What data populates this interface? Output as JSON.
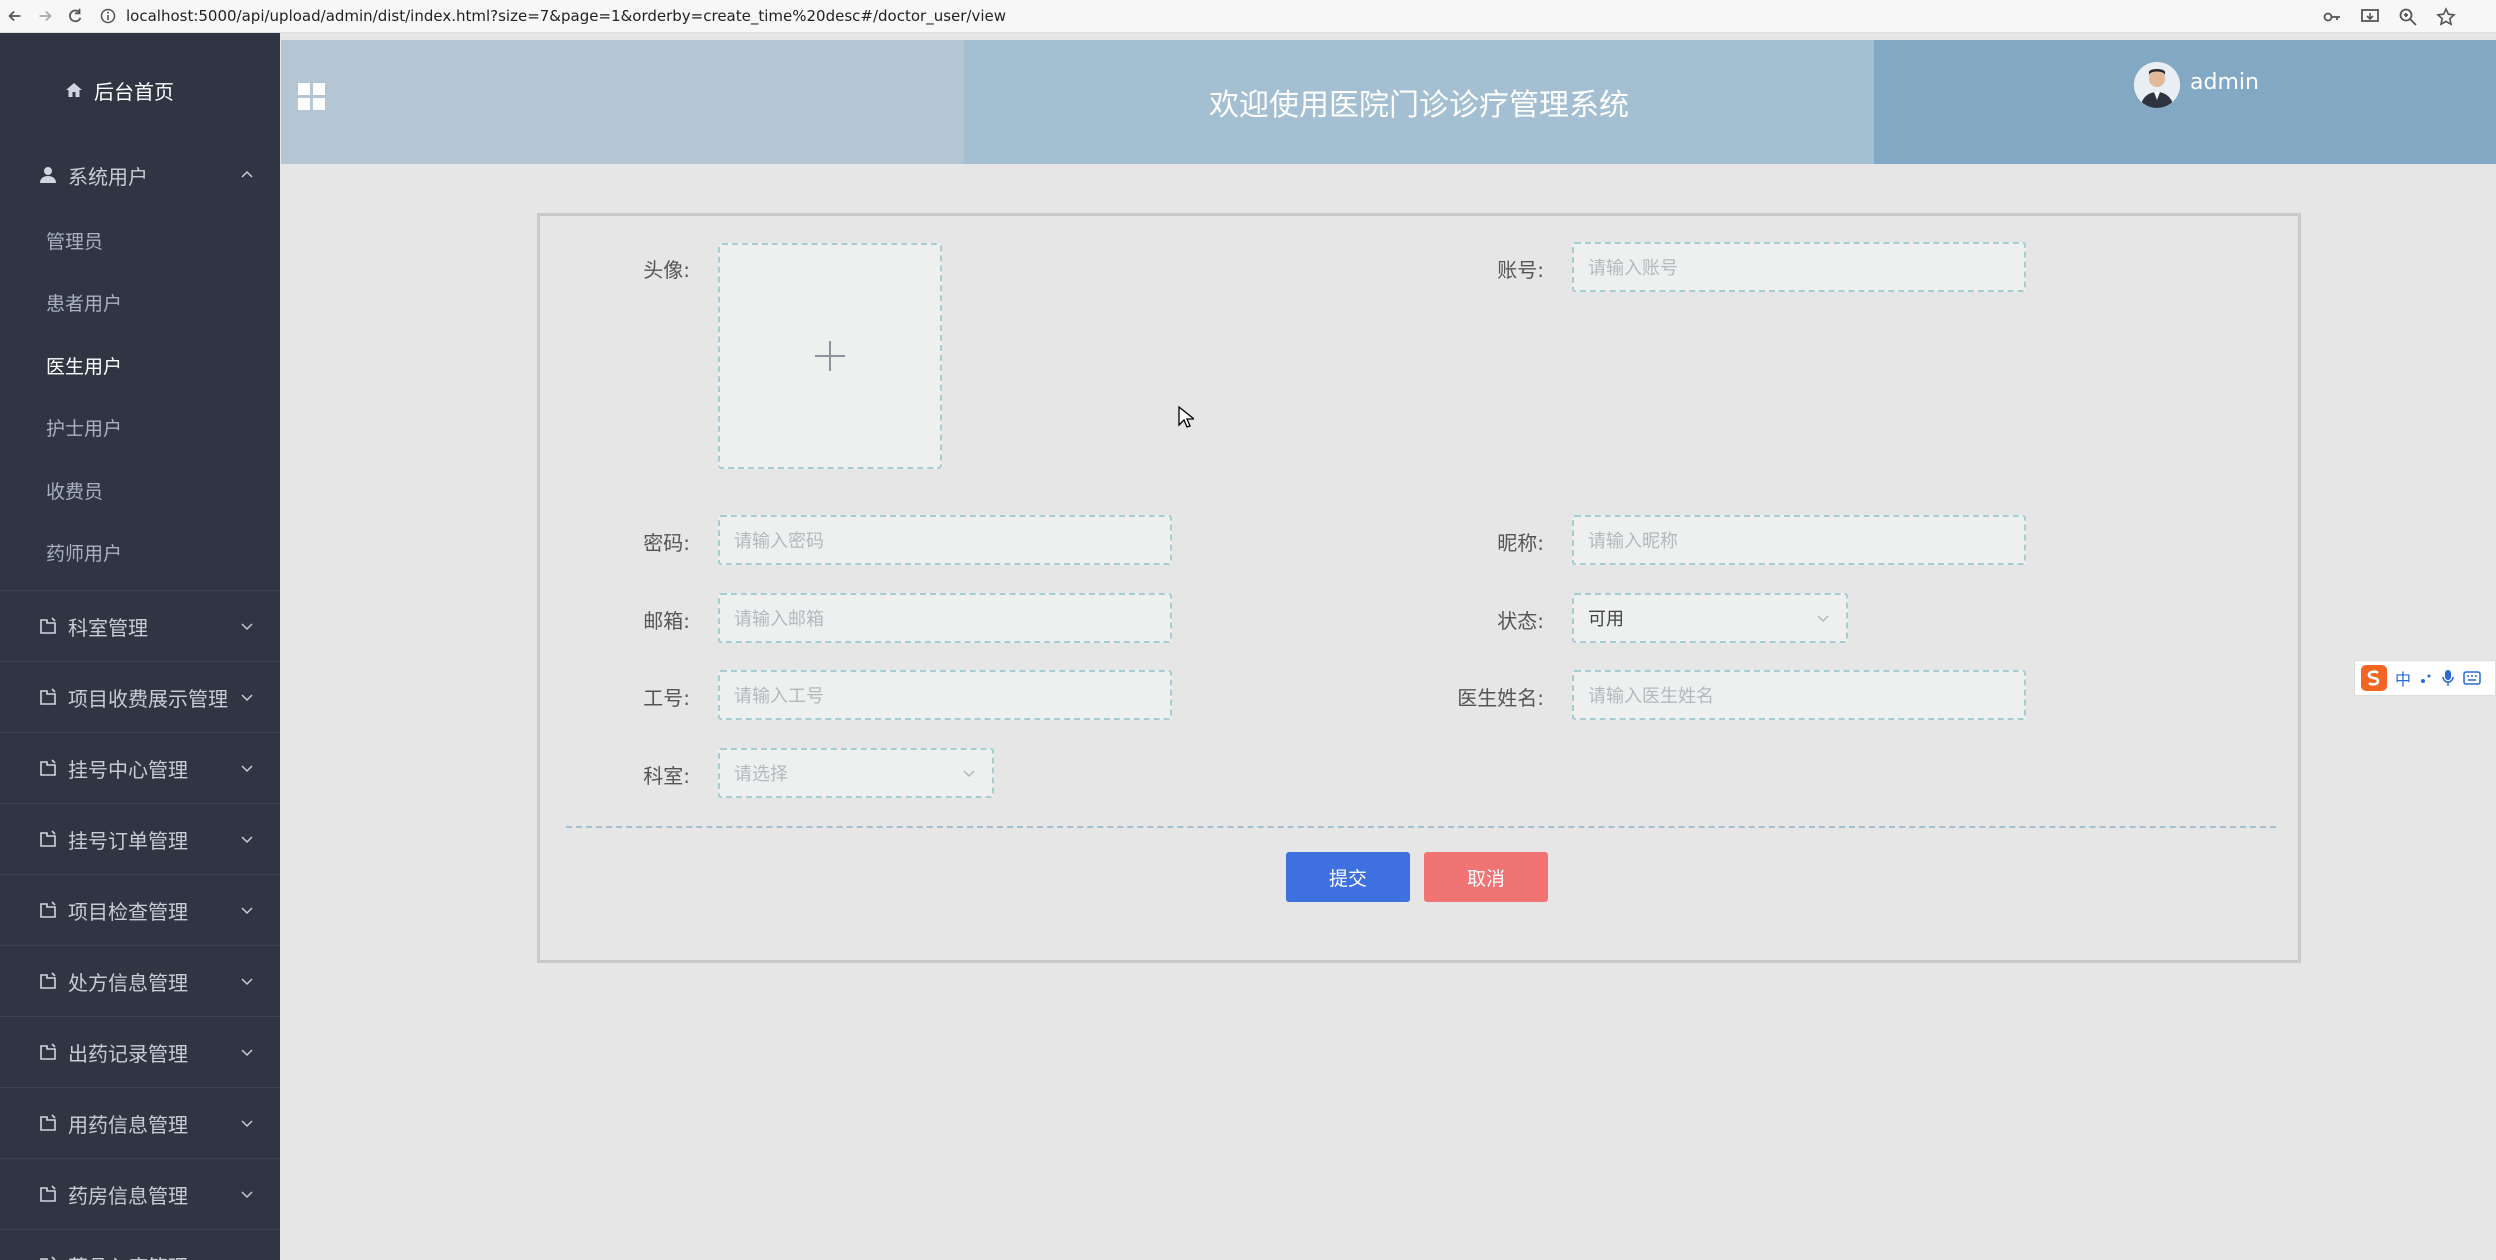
{
  "browser": {
    "url": "localhost:5000/api/upload/admin/dist/index.html?size=7&page=1&orderby=create_time%20desc#/doctor_user/view"
  },
  "sidebar": {
    "home": "后台首页",
    "open_group": "系统用户",
    "sub_items": [
      "管理员",
      "患者用户",
      "医生用户",
      "护士用户",
      "收费员",
      "药师用户"
    ],
    "active_sub": "医生用户",
    "groups": [
      "科室管理",
      "项目收费展示管理",
      "挂号中心管理",
      "挂号订单管理",
      "项目检查管理",
      "处方信息管理",
      "出药记录管理",
      "用药信息管理",
      "药房信息管理",
      "药品入库管理"
    ]
  },
  "header": {
    "title": "欢迎使用医院门诊诊疗管理系统",
    "user": "admin"
  },
  "form": {
    "avatar_label": "头像:",
    "account_label": "账号:",
    "account_placeholder": "请输入账号",
    "password_label": "密码:",
    "password_placeholder": "请输入密码",
    "nickname_label": "昵称:",
    "nickname_placeholder": "请输入昵称",
    "email_label": "邮箱:",
    "email_placeholder": "请输入邮箱",
    "status_label": "状态:",
    "status_value": "可用",
    "jobno_label": "工号:",
    "jobno_placeholder": "请输入工号",
    "doctor_name_label": "医生姓名:",
    "doctor_name_placeholder": "请输入医生姓名",
    "dept_label": "科室:",
    "dept_placeholder": "请选择",
    "submit": "提交",
    "cancel": "取消"
  },
  "ime": {
    "mode": "中"
  }
}
